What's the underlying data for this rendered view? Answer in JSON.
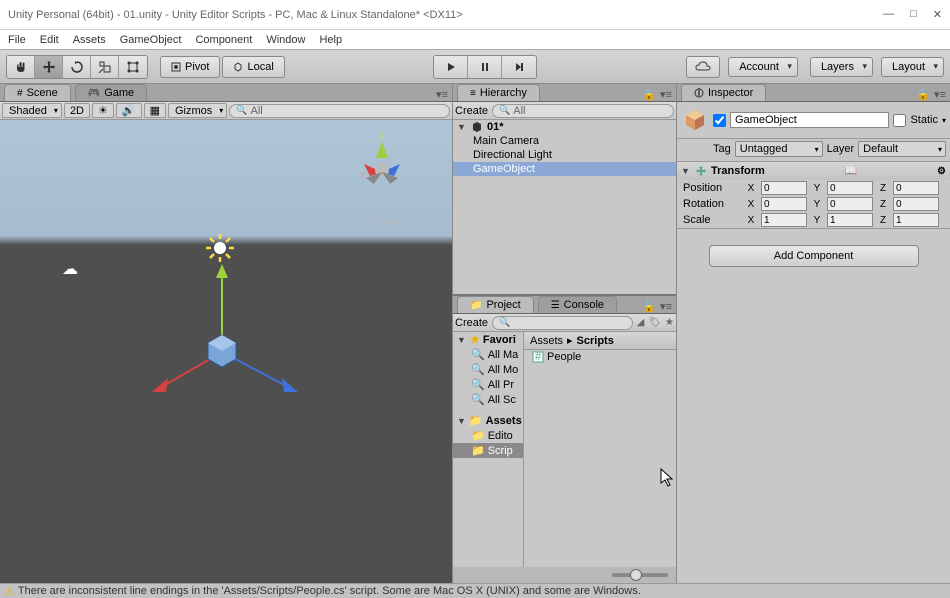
{
  "title": "Unity Personal (64bit) - 01.unity - Unity Editor Scripts - PC, Mac & Linux Standalone* <DX11>",
  "menu": [
    "File",
    "Edit",
    "Assets",
    "GameObject",
    "Component",
    "Window",
    "Help"
  ],
  "toolbar": {
    "pivot": "Pivot",
    "local": "Local",
    "account": "Account",
    "layers": "Layers",
    "layout": "Layout"
  },
  "tabs": {
    "scene": "Scene",
    "game": "Game",
    "hierarchy": "Hierarchy",
    "project": "Project",
    "console": "Console",
    "inspector": "Inspector"
  },
  "scene_toolbar": {
    "shaded": "Shaded",
    "td": "2D",
    "gizmos": "Gizmos",
    "search_ph": "All"
  },
  "hierarchy": {
    "create": "Create",
    "search_ph": "All",
    "scene": "01*",
    "items": [
      "Main Camera",
      "Directional Light",
      "GameObject"
    ]
  },
  "project": {
    "create": "Create",
    "favorites": "Favori",
    "fav_items": [
      "All Ma",
      "All Mo",
      "All Pr",
      "All Sc"
    ],
    "assets": "Assets",
    "folders": [
      "Edito",
      "Scrip"
    ],
    "breadcrumb": [
      "Assets",
      "Scripts"
    ],
    "files": [
      "People"
    ]
  },
  "inspector": {
    "name": "GameObject",
    "static": "Static",
    "tag_lbl": "Tag",
    "tag": "Untagged",
    "layer_lbl": "Layer",
    "layer": "Default",
    "transform": "Transform",
    "position": "Position",
    "rotation": "Rotation",
    "scale": "Scale",
    "pos": {
      "x": "0",
      "y": "0",
      "z": "0"
    },
    "rot": {
      "x": "0",
      "y": "0",
      "z": "0"
    },
    "scl": {
      "x": "1",
      "y": "1",
      "z": "1"
    },
    "addcomp": "Add Component"
  },
  "persp": "Persp",
  "status": "There are inconsistent line endings in the 'Assets/Scripts/People.cs' script. Some are Mac OS X (UNIX) and some are Windows."
}
